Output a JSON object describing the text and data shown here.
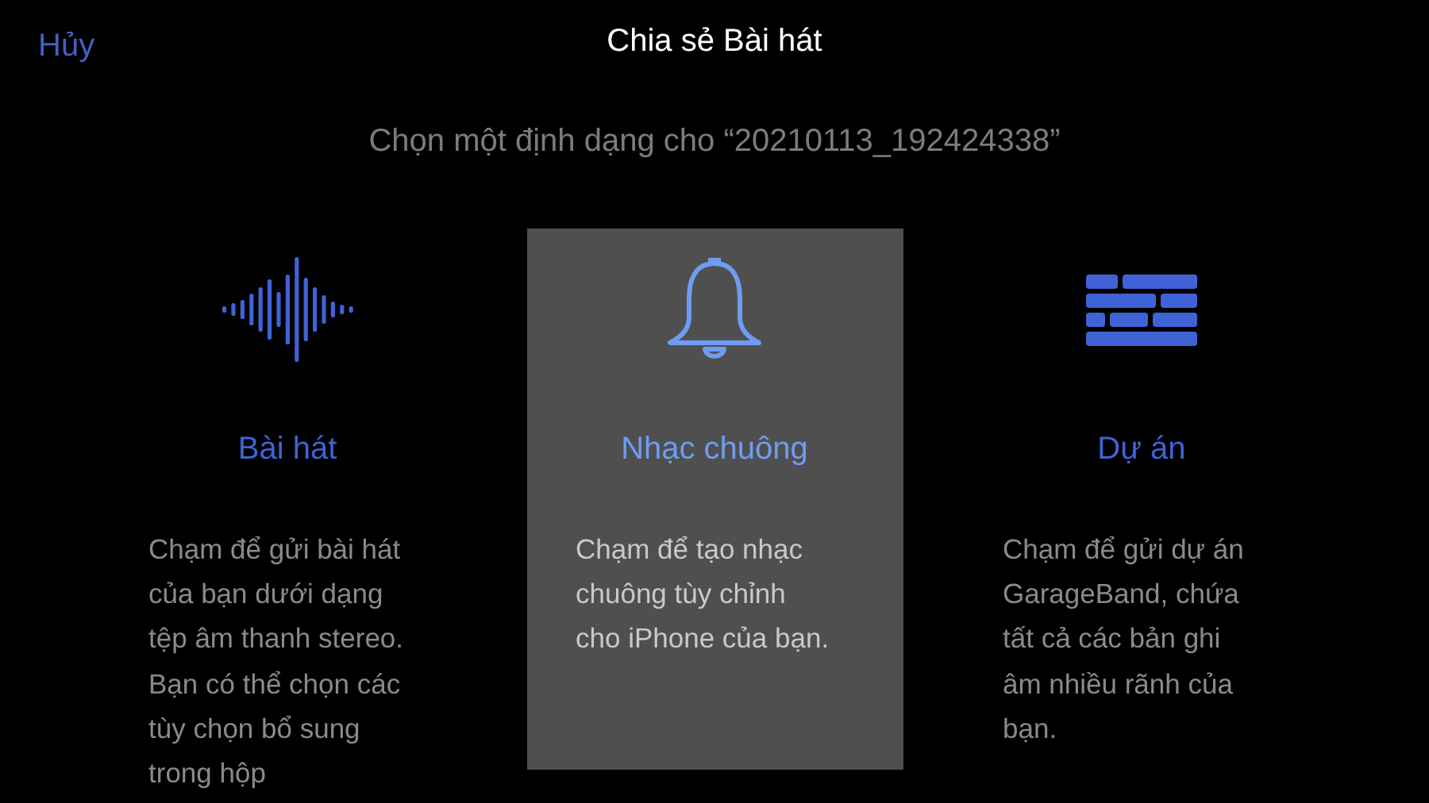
{
  "header": {
    "cancel": "Hủy",
    "title": "Chia sẻ Bài hát"
  },
  "prompt": "Chọn một định dạng cho “20210113_192424338”",
  "options": [
    {
      "kind": "waveform",
      "title": "Bài hát",
      "description": "Chạm để gửi bài hát của bạn dưới dạng tệp âm thanh stereo. Bạn có thể chọn các tùy chọn bổ sung trong hộp",
      "selected": false
    },
    {
      "kind": "bell",
      "title": "Nhạc chuông",
      "description": "Chạm để tạo nhạc chuông tùy chỉnh cho iPhone của bạn.",
      "selected": true
    },
    {
      "kind": "bricks",
      "title": "Dự án",
      "description": "Chạm để gửi dự án GarageBand, chứa tất cả các bản ghi âm nhiều rãnh của bạn.",
      "selected": false
    }
  ]
}
